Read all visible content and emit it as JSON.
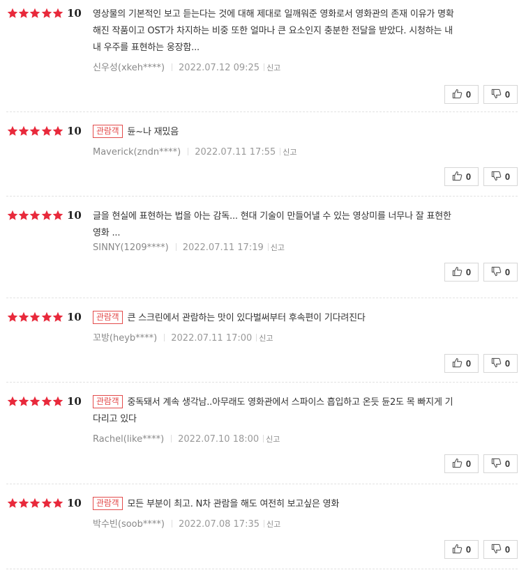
{
  "colors": {
    "star": "#e8293b",
    "badge": "#e34b4b"
  },
  "icons": {
    "star": "star-icon",
    "like": "thumbs-up-icon",
    "dislike": "thumbs-down-icon"
  },
  "reviews": [
    {
      "rating": 5,
      "score": "10",
      "badge": "",
      "lines": [
        "영상물의 기본적인 보고 듣는다는 것에 대해 제대로 일깨워준 영화로서 영화관의 존재 이유가 명확",
        "해진 작품이고 OST가 차지하는 비중 또한 얼마나 큰 요소인지 충분한 전달을 받았다. 시청하는 내",
        "내 우주를 표현하는 웅장함..."
      ],
      "author": "신우성(xkeh****)",
      "date": "2022.07.12 09:25",
      "report": "신고",
      "likes": "0",
      "dislikes": "0"
    },
    {
      "rating": 5,
      "score": "10",
      "badge": "관람객",
      "lines": [
        "듄~나 재밌음"
      ],
      "author": "Maverick(zndn****)",
      "date": "2022.07.11 17:55",
      "report": "신고",
      "likes": "0",
      "dislikes": "0"
    },
    {
      "rating": 5,
      "score": "10",
      "badge": "",
      "lines": [
        "글을 현실에 표현하는 법을 아는 감독... 현대 기술이 만들어낼 수 있는 영상미를 너무나 잘 표현한",
        "영화 ..."
      ],
      "author": "SINNY(1209****)",
      "date": "2022.07.11 17:19",
      "report": "신고",
      "likes": "0",
      "dislikes": "0"
    },
    {
      "rating": 5,
      "score": "10",
      "badge": "관람객",
      "lines": [
        "큰 스크린에서 관람하는 맛이 있다벌써부터 후속편이 기다려진다"
      ],
      "author": "꼬방(heyb****)",
      "date": "2022.07.11 17:00",
      "report": "신고",
      "likes": "0",
      "dislikes": "0"
    },
    {
      "rating": 5,
      "score": "10",
      "badge": "관람객",
      "lines": [
        "중독돼서 계속 생각남..아무래도 영화관에서 스파이스 흡입하고 온듯 듄2도 목 빠지게 기",
        "다리고 있다"
      ],
      "author": "Rachel(like****)",
      "date": "2022.07.10 18:00",
      "report": "신고",
      "likes": "0",
      "dislikes": "0"
    },
    {
      "rating": 5,
      "score": "10",
      "badge": "관람객",
      "lines": [
        "모든 부분이 최고. N차 관람을 해도 여전히 보고싶은 영화"
      ],
      "author": "박수빈(soob****)",
      "date": "2022.07.08 17:35",
      "report": "신고",
      "likes": "0",
      "dislikes": "0"
    }
  ]
}
